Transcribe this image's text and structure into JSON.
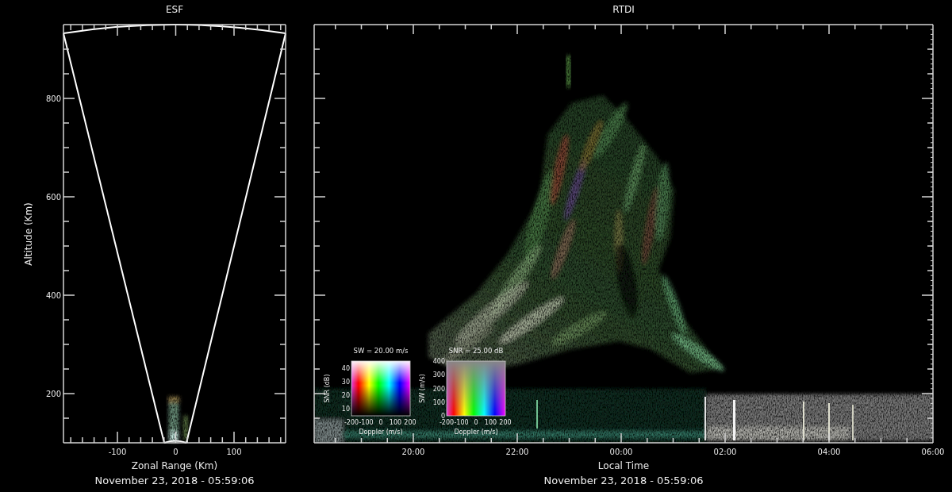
{
  "panels": [
    {
      "kind": "fan",
      "title": "ESF",
      "ylabel": "Altitude (Km)",
      "yticks": [
        "800",
        "600",
        "400",
        "200"
      ],
      "xticks": [
        "-100",
        "0",
        "100"
      ],
      "xlabel": "Zonal Range (Km)",
      "timestamp": "November 23, 2018 - 05:59:06"
    },
    {
      "kind": "rtdi",
      "title": "RTDI",
      "xticks": [
        "20:00",
        "22:00",
        "00:00",
        "02:00",
        "04:00",
        "06:00"
      ],
      "xlabel": "Local Time",
      "timestamp": "November 23, 2018 - 05:59:06",
      "legends": [
        {
          "kind": "snr",
          "title": "SW = 20.00 m/s",
          "ylabel": "SNR (dB)",
          "yticks": [
            "40",
            "30",
            "20",
            "10"
          ],
          "xticks": [
            "-200",
            "-100",
            "0",
            "100",
            "200"
          ],
          "xlabel": "Doppler (m/s)"
        },
        {
          "kind": "sw",
          "title": "SNR = 25.00 dB",
          "ylabel": "SW (m/s)",
          "yticks": [
            "400",
            "300",
            "200",
            "100",
            "0"
          ],
          "xticks": [
            "-200",
            "-100",
            "0",
            "100",
            "200"
          ],
          "xlabel": "Doppler (m/s)"
        }
      ]
    }
  ]
}
